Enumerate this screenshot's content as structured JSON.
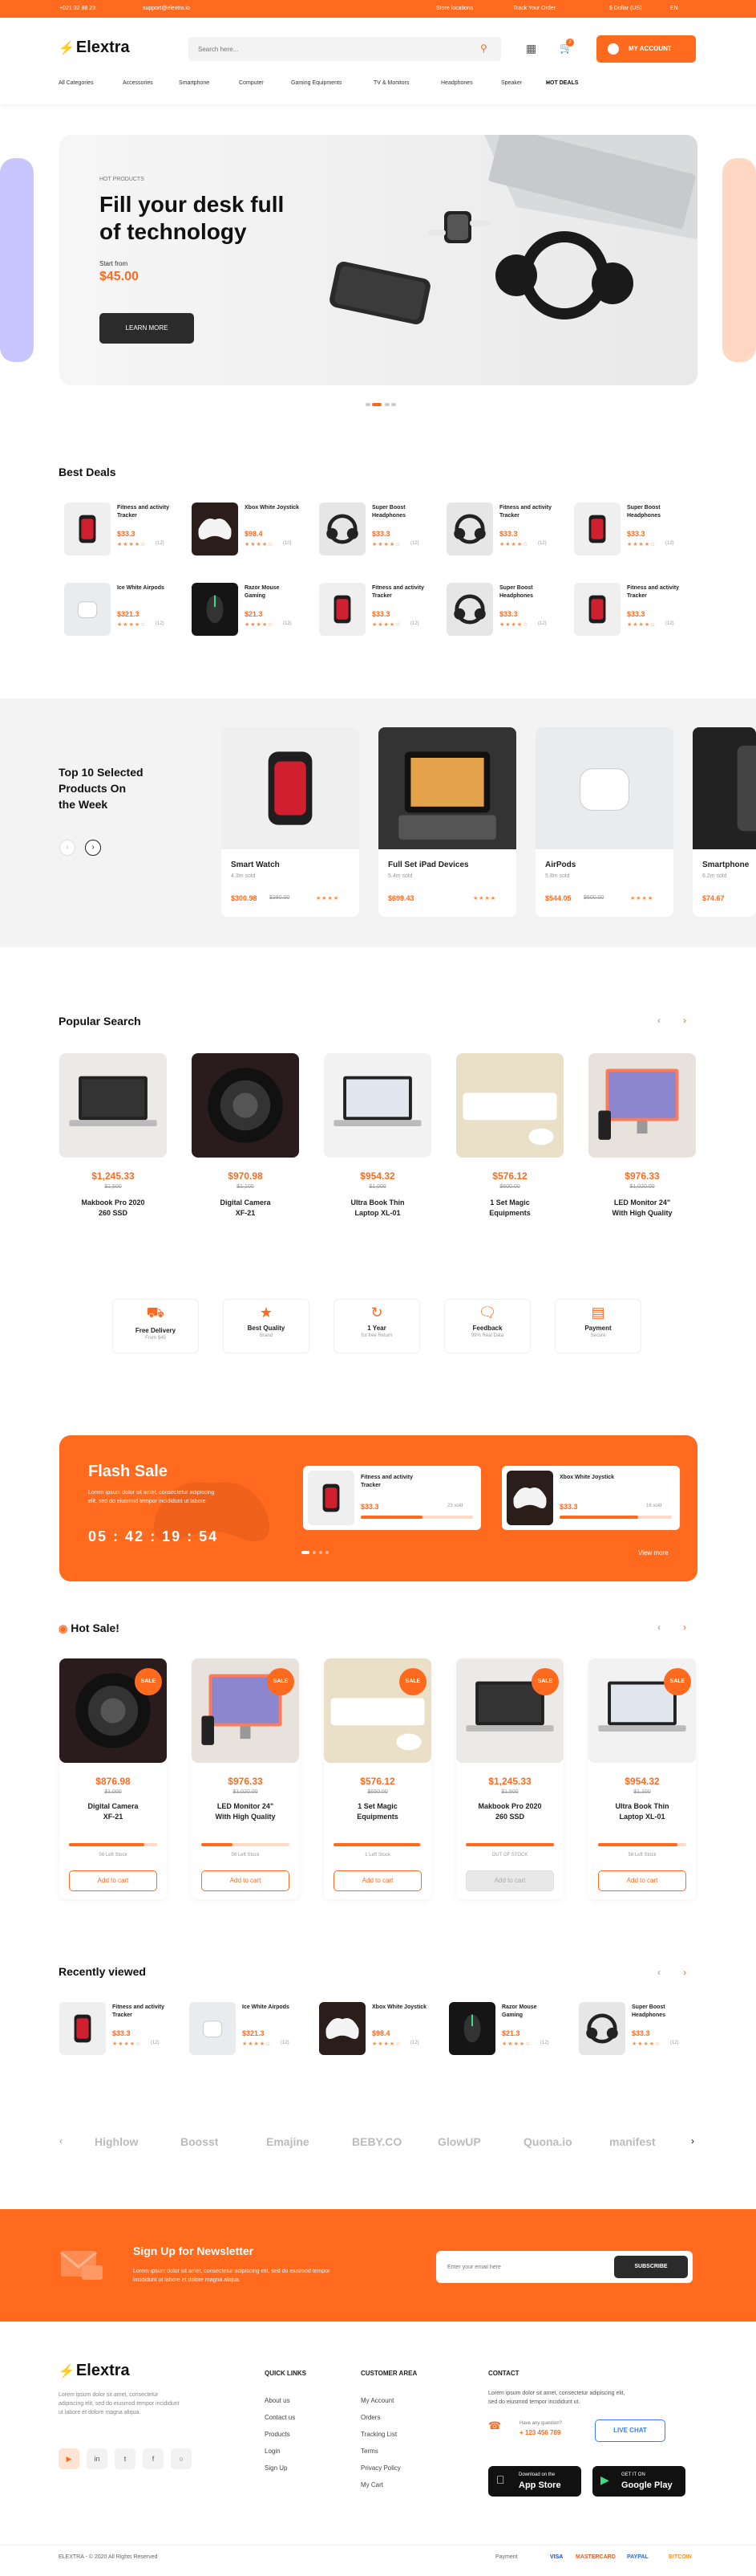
{
  "topbar": {
    "phone": "+021 32 88 23",
    "email": "support@elextra.io",
    "store": "Store locations",
    "track": "Track Your Order",
    "currency": "$ Dollar (US)",
    "lang": "EN"
  },
  "header": {
    "logo": "Elextra",
    "search_placeholder": "Search here...",
    "cart_count": "2",
    "account_label": "MY ACCOUNT"
  },
  "nav": [
    "All Categories",
    "Accessories",
    "Smartphone",
    "Computer",
    "Gaming Equipments",
    "TV & Monitors",
    "Headphones",
    "Speaker",
    "HOT DEALS"
  ],
  "hero": {
    "eyebrow": "HOT PRODUCTS",
    "title_line1": "Fill your desk full",
    "title_line2": "of technology",
    "start_from": "Start from",
    "price": "$45.00",
    "cta": "LEARN MORE"
  },
  "best_deals": {
    "title": "Best Deals",
    "items": [
      {
        "name": "Fitness and activity Tracker",
        "price": "$33.3",
        "rating": "(12)",
        "img": "watch"
      },
      {
        "name": "Xbox White Joystick",
        "price": "$98.4",
        "rating": "(10)",
        "img": "joystick"
      },
      {
        "name": "Super Boost Headphones",
        "price": "$33.3",
        "rating": "(12)",
        "img": "headphones"
      },
      {
        "name": "Fitness and activity Tracker",
        "price": "$33.3",
        "rating": "(12)",
        "img": "headphones"
      },
      {
        "name": "Super Boost Headphones",
        "price": "$33.3",
        "rating": "(12)",
        "img": "watch"
      },
      {
        "name": "Ice White Airpods",
        "price": "$321.3",
        "rating": "(12)",
        "img": "airpods"
      },
      {
        "name": "Razor Mouse Gaming",
        "price": "$21.3",
        "rating": "(12)",
        "img": "mouse"
      },
      {
        "name": "Fitness and activity Tracker",
        "price": "$33.3",
        "rating": "(12)",
        "img": "watch"
      },
      {
        "name": "Super Boost Headphones",
        "price": "$33.3",
        "rating": "(12)",
        "img": "headphones"
      },
      {
        "name": "Fitness and activity Tracker",
        "price": "$33.3",
        "rating": "(12)",
        "img": "watch"
      }
    ]
  },
  "top10": {
    "title_line1": "Top 10 Selected",
    "title_line2": "Products On",
    "title_line3": "the Week",
    "items": [
      {
        "name": "Smart Watch",
        "sold": "4.3m sold",
        "price": "$300.98",
        "old": "$380.00",
        "img": "watch"
      },
      {
        "name": "Full Set iPad Devices",
        "sold": "5.4m sold",
        "price": "$699.43",
        "old": "",
        "img": "ipad"
      },
      {
        "name": "AirPods",
        "sold": "5.8m sold",
        "price": "$544.05",
        "old": "$600.00",
        "img": "airpods"
      },
      {
        "name": "Smartphone",
        "sold": "6.2m sold",
        "price": "$74.67",
        "old": "",
        "img": "phone"
      }
    ]
  },
  "popular": {
    "title": "Popular Search",
    "items": [
      {
        "price": "$1,245.33",
        "old": "$1,500",
        "name1": "Makbook Pro 2020",
        "name2": "260 SSD",
        "img": "laptop"
      },
      {
        "price": "$970.98",
        "old": "$1,100",
        "name1": "Digital Camera",
        "name2": "XF-21",
        "img": "camera"
      },
      {
        "price": "$954.32",
        "old": "$1,000",
        "name1": "Ultra Book Thin",
        "name2": "Laptop XL-01",
        "img": "laptop2"
      },
      {
        "price": "$576.12",
        "old": "$600.00",
        "name1": "1 Set Magic",
        "name2": "Equipments",
        "img": "keyboard"
      },
      {
        "price": "$976.33",
        "old": "$1,020.00",
        "name1": "LED Monitor 24\"",
        "name2": "With High Quality",
        "img": "monitor"
      }
    ]
  },
  "features": [
    {
      "title": "Free Delivery",
      "sub": "From $45"
    },
    {
      "title": "Best Quality",
      "sub": "Brand"
    },
    {
      "title": "1 Year",
      "sub": "for free Return"
    },
    {
      "title": "Feedback",
      "sub": "99% Real Data"
    },
    {
      "title": "Payment",
      "sub": "Secure"
    }
  ],
  "flash": {
    "title": "Flash Sale",
    "desc1": "Lorem ipsum dolor sit amet, consectetur adipiscing",
    "desc2": "elit, sed do eiusmod tempor incididunt ut labore",
    "hh": "05",
    "mm": "42",
    "ss": "19",
    "ms": "54",
    "view_more": "View more",
    "items": [
      {
        "name1": "Fitness and activity",
        "name2": "Tracker",
        "price": "$33.3",
        "sold": "23 sold",
        "progress": 0.55,
        "img": "watch"
      },
      {
        "name1": "Xbox White Joystick",
        "name2": "",
        "price": "$33.3",
        "sold": "16 sold",
        "progress": 0.7,
        "img": "joystick"
      }
    ]
  },
  "hot": {
    "title": "Hot Sale!",
    "sale": "SALE",
    "add": "Add to cart",
    "items": [
      {
        "price": "$876.98",
        "old": "$1,000",
        "name1": "Digital Camera",
        "name2": "XF-21",
        "stock": "56 Left Stock",
        "progress": 0.85,
        "img": "camera",
        "out": false
      },
      {
        "price": "$976.33",
        "old": "$1,020.00",
        "name1": "LED Monitor 24\"",
        "name2": "With High Quality",
        "stock": "56 Left Stock",
        "progress": 0.35,
        "img": "monitor",
        "out": false
      },
      {
        "price": "$576.12",
        "old": "$650.00",
        "name1": "1 Set Magic",
        "name2": "Equipments",
        "stock": "1 Left Stock",
        "progress": 0.98,
        "img": "keyboard",
        "out": false
      },
      {
        "price": "$1,245.33",
        "old": "$1,500",
        "name1": "Makbook Pro 2020",
        "name2": "260 SSD",
        "stock": "OUT OF STOCK",
        "progress": 1,
        "img": "laptop",
        "out": true
      },
      {
        "price": "$954.32",
        "old": "$1,100",
        "name1": "Ultra Book Thin",
        "name2": "Laptop XL-01",
        "stock": "56 Left Stock",
        "progress": 0.9,
        "img": "laptop2",
        "out": false
      }
    ]
  },
  "recent": {
    "title": "Recently viewed",
    "items": [
      {
        "name": "Fitness and activity Tracker",
        "price": "$33.3",
        "rating": "(12)",
        "img": "watch"
      },
      {
        "name": "Ice White Airpods",
        "price": "$321.3",
        "rating": "(12)",
        "img": "airpods"
      },
      {
        "name": "Xbox White Joystick",
        "price": "$98.4",
        "rating": "(12)",
        "img": "joystick"
      },
      {
        "name": "Razor Mouse Gaming",
        "price": "$21.3",
        "rating": "(12)",
        "img": "mouse"
      },
      {
        "name": "Super Boost Headphones",
        "price": "$33.3",
        "rating": "(12)",
        "img": "headphones"
      }
    ]
  },
  "brands": [
    "Highlow",
    "Boosst",
    "Emajine",
    "BEBY.CO",
    "GlowUP",
    "Quona.io",
    "manifest"
  ],
  "newsletter": {
    "title": "Sign Up for Newsletter",
    "desc1": "Lorem ipsum dolor sit amet, consectetur adipiscing elit, sed do eiusmod tempor",
    "desc2": "incididunt ut labore et dolore magna aliqua.",
    "placeholder": "Enter your email here",
    "button": "SUBSCRIBE"
  },
  "footer": {
    "logo": "Elextra",
    "about1": "Lorem ipsum dolor sit amet, consectetur",
    "about2": "adipiscing elit, sed do eiusmod tempor incididunt",
    "about3": "ut labore et dolore magna aliqua.",
    "quick_title": "QUICK LINKS",
    "quick": [
      "About us",
      "Contact us",
      "Products",
      "Login",
      "Sign Up"
    ],
    "cust_title": "CUSTOMER AREA",
    "cust": [
      "My Account",
      "Orders",
      "Tracking List",
      "Terms",
      "Privacy Policy",
      "My Cart"
    ],
    "contact_title": "CONTACT",
    "contact1": "Lorem ipsum dolor sit amet, consectetur adipiscing elit,",
    "contact2": "sed do eiusmod tempor incididunt ut.",
    "question": "Have any question?",
    "phone": "+ 123 456 789",
    "live_chat": "LIVE CHAT",
    "appstore_small": "Download on the",
    "appstore": "App Store",
    "gplay_small": "GET IT ON",
    "gplay": "Google Play",
    "copyright": "ELEXTRA  -  © 2020 All Rights Reserved",
    "payment": "Payment",
    "pay": [
      "VISA",
      "MASTERCARD",
      "PAYPAL",
      "BITCOIN"
    ]
  },
  "colors": {
    "accent": "#ff6a1f",
    "dark": "#2b2b2b"
  }
}
